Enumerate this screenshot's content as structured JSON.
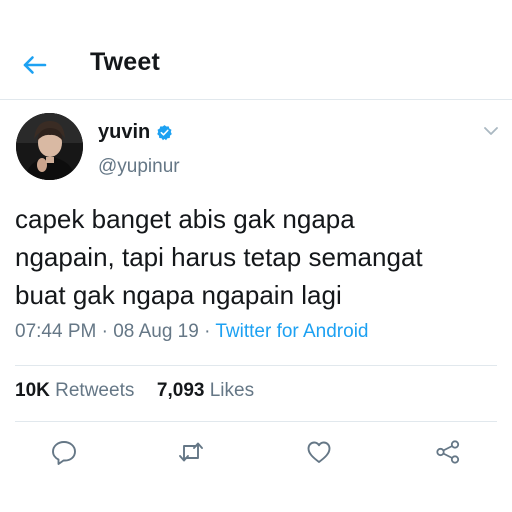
{
  "header": {
    "title": "Tweet",
    "back_icon": "back-arrow-icon",
    "accent_color": "#1da1f2"
  },
  "author": {
    "display_name": "yuvin",
    "handle": "@yupinur",
    "verified": true,
    "verified_color": "#1da1f2"
  },
  "tweet": {
    "text": "capek banget abis gak ngapa\nngapain, tapi harus tetap semangat\nbuat gak ngapa ngapain lagi",
    "time": "07:44 PM",
    "separator": "·",
    "date": "08 Aug 19",
    "source": "Twitter for Android"
  },
  "stats": {
    "retweets_count": "10K",
    "retweets_label": "Retweets",
    "likes_count": "7,093",
    "likes_label": "Likes"
  },
  "actions": {
    "reply_icon": "reply-icon",
    "retweet_icon": "retweet-icon",
    "like_icon": "heart-icon",
    "share_icon": "share-icon"
  }
}
